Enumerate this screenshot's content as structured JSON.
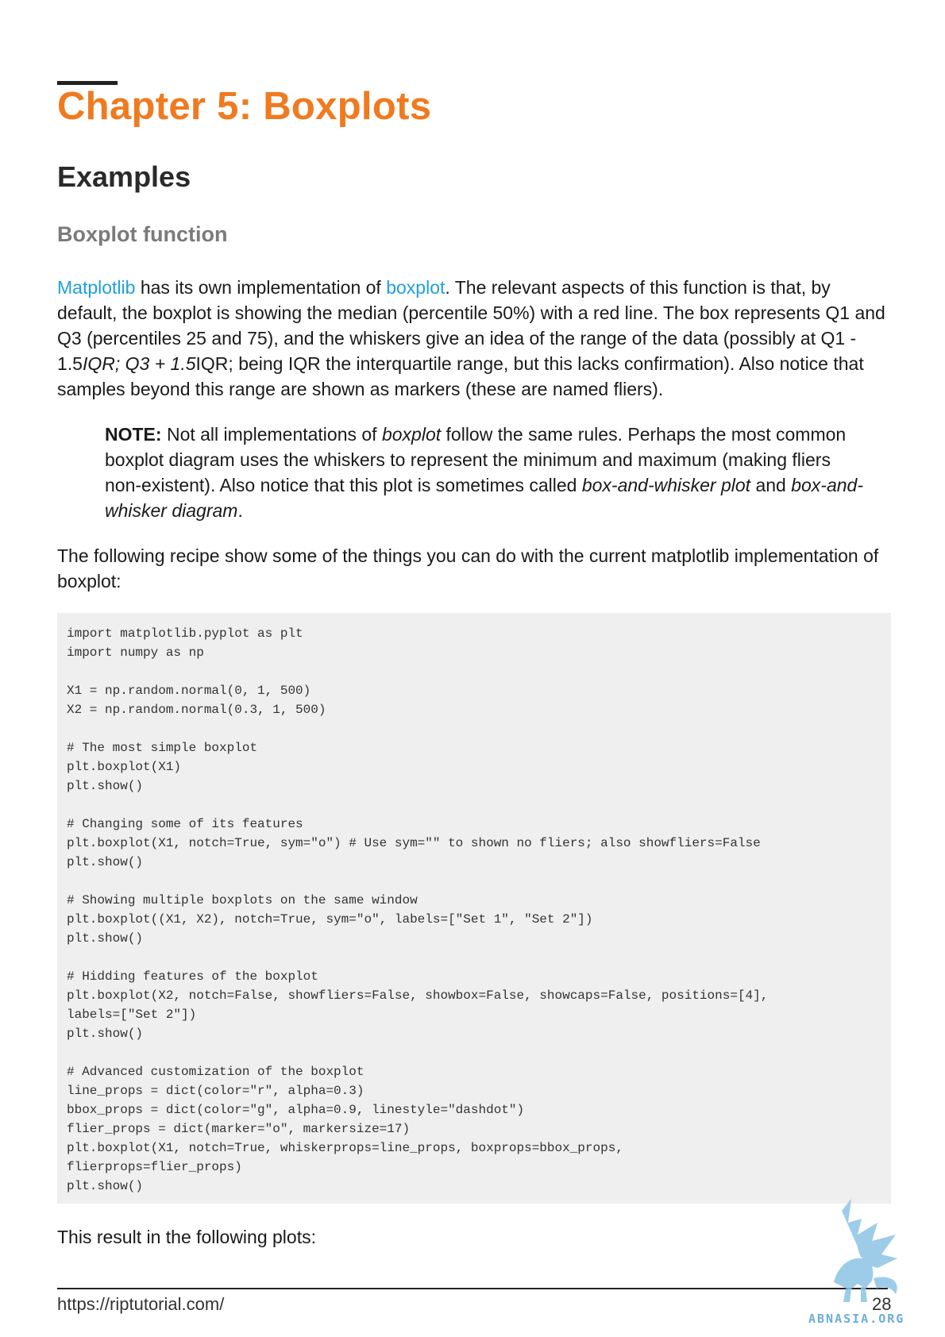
{
  "chapter": {
    "title": "Chapter 5: Boxplots"
  },
  "section": {
    "title": "Examples"
  },
  "subsection": {
    "title": "Boxplot function"
  },
  "intro": {
    "link1": "Matplotlib",
    "t1": " has its own implementation of ",
    "link2": "boxplot",
    "t2": ". The relevant aspects of this function is that, by default, the boxplot is showing the median (percentile 50%) with a red line. The box represents Q1 and Q3 (percentiles 25 and 75), and the whiskers give an idea of the range of the data (possibly at Q1 - 1.5",
    "italic": "IQR; Q3 + 1.5",
    "t3": "IQR; being IQR the interquartile range, but this lacks confirmation). Also notice that samples beyond this range are shown as markers (these are named fliers)."
  },
  "note": {
    "label": "NOTE:",
    "t1": " Not all implementations of ",
    "i1": "boxplot",
    "t2": " follow the same rules. Perhaps the most common boxplot diagram uses the whiskers to represent the minimum and maximum (making fliers non-existent). Also notice that this plot is sometimes called ",
    "i2": "box-and-whisker plot",
    "t3": " and ",
    "i3": "box-and-whisker diagram",
    "t4": "."
  },
  "recipe_text": "The following recipe show some of the things you can do with the current matplotlib implementation of boxplot:",
  "code_lines": [
    "import matplotlib.pyplot as plt",
    "import numpy as np",
    "",
    "X1 = np.random.normal(0, 1, 500)",
    "X2 = np.random.normal(0.3, 1, 500)",
    "",
    "# The most simple boxplot",
    "plt.boxplot(X1)",
    "plt.show()",
    "",
    "# Changing some of its features",
    "plt.boxplot(X1, notch=True, sym=\"o\") # Use sym=\"\" to shown no fliers; also showfliers=False",
    "plt.show()",
    "",
    "# Showing multiple boxplots on the same window",
    "plt.boxplot((X1, X2), notch=True, sym=\"o\", labels=[\"Set 1\", \"Set 2\"])",
    "plt.show()",
    "",
    "# Hidding features of the boxplot",
    "plt.boxplot(X2, notch=False, showfliers=False, showbox=False, showcaps=False, positions=[4],",
    "labels=[\"Set 2\"])",
    "plt.show()",
    "",
    "# Advanced customization of the boxplot",
    "line_props = dict(color=\"r\", alpha=0.3)",
    "bbox_props = dict(color=\"g\", alpha=0.9, linestyle=\"dashdot\")",
    "flier_props = dict(marker=\"o\", markersize=17)",
    "plt.boxplot(X1, notch=True, whiskerprops=line_props, boxprops=bbox_props,",
    "flierprops=flier_props)",
    "plt.show()"
  ],
  "result_text": "This result in the following plots:",
  "footer": {
    "url": "https://riptutorial.com/",
    "page": "28"
  },
  "watermark": {
    "text": "ABNASIA.ORG",
    "icon": "griffin-logo-icon"
  },
  "colors": {
    "chapter": "#f07a1f",
    "link": "#1ea0e0",
    "code_bg": "#efefef",
    "subsection": "#7a7a7a"
  }
}
